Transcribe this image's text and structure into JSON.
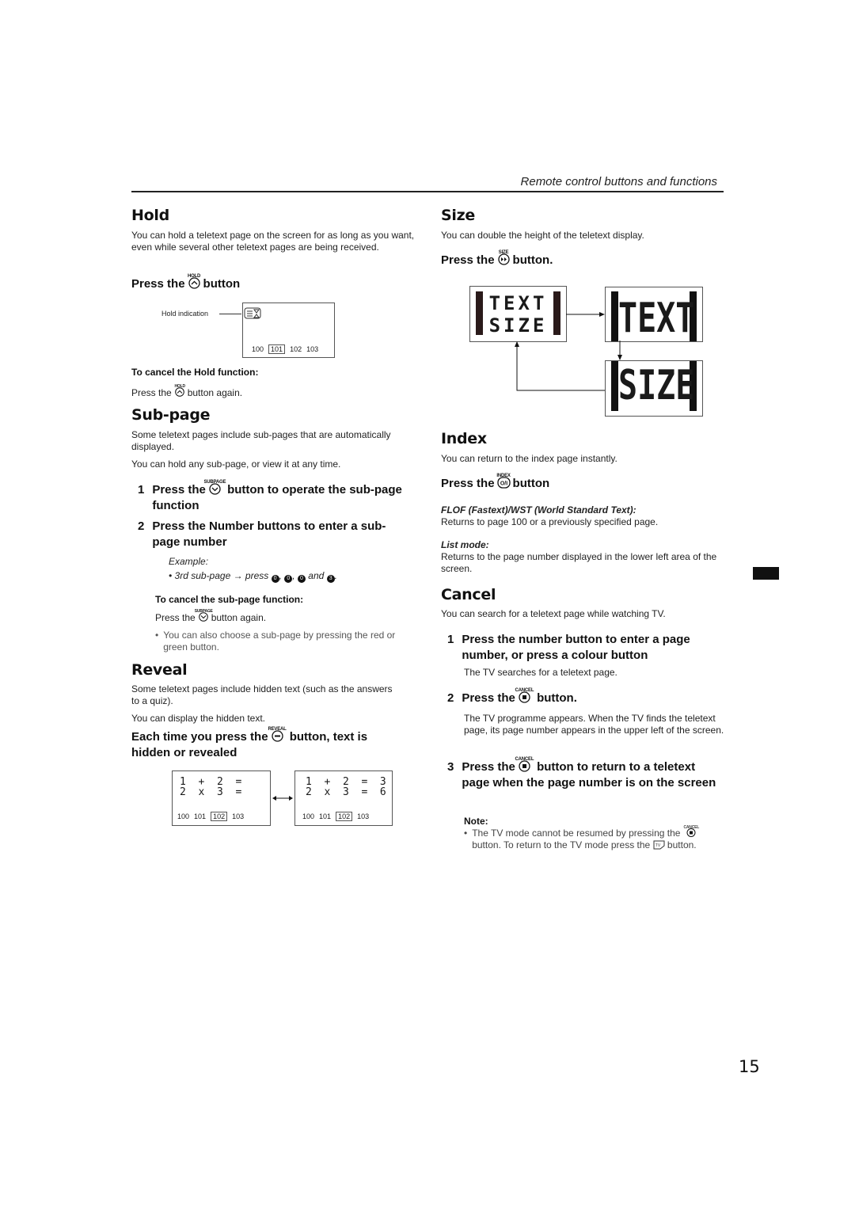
{
  "header": {
    "section": "Remote control buttons and functions"
  },
  "page_number": "15",
  "hold": {
    "title": "Hold",
    "intro": "You can hold a teletext page on the screen for as long as you want, even while several other teletext pages are being received.",
    "press_pre": "Press the",
    "button_label": "HOLD",
    "press_post": "button",
    "indication_label": "Hold indication",
    "pages": [
      "100",
      "101",
      "102",
      "103"
    ],
    "cancel_title": "To cancel the Hold function:",
    "cancel_pre": "Press the",
    "cancel_post": "button again."
  },
  "subpage": {
    "title": "Sub-page",
    "intro1": "Some teletext pages include sub-pages that are automatically displayed.",
    "intro2": "You can hold any sub-page, or view it at any time.",
    "button_label": "SUBPAGE",
    "step1_num": "1",
    "step1_pre": "Press the",
    "step1_post": "button to operate the sub-page function",
    "step2_num": "2",
    "step2": "Press the Number buttons to enter a sub-page number",
    "example_label": "Example:",
    "example_pre": "• 3rd sub-page → press",
    "example_keys": [
      "0",
      "0",
      "0",
      "3"
    ],
    "example_and": "and",
    "cancel_title": "To cancel the sub-page function:",
    "cancel_pre": "Press the",
    "cancel_post": "button again.",
    "note": "You can also choose a sub-page by pressing the red or green button."
  },
  "reveal": {
    "title": "Reveal",
    "intro1": "Some teletext pages include hidden text (such as the answers to a quiz).",
    "intro2": "You can display the hidden text.",
    "button_label": "REVEAL",
    "step_pre": "Each time you press the",
    "step_post": "button, text is hidden or revealed",
    "hidden_screen": {
      "line1": "1  +  2  =",
      "line2": "2  x  3  ="
    },
    "revealed_screen": {
      "line1": "1  +  2  =  3",
      "line2": "2  x  3  =  6"
    },
    "pages": [
      "100",
      "101",
      "102",
      "103"
    ]
  },
  "size": {
    "title": "Size",
    "intro": "You can double the height of the teletext display.",
    "press_pre": "Press the",
    "button_label": "SIZE",
    "press_post": "button.",
    "line1": "TEXT",
    "line2": "SIZE"
  },
  "index": {
    "title": "Index",
    "intro": "You can return to the index page instantly.",
    "press_pre": "Press the",
    "button_label": "INDEX",
    "press_post": "button",
    "flof_title": "FLOF (Fastext)/WST (World Standard Text):",
    "flof_text": "Returns to page 100 or a previously specified page.",
    "list_title": "List mode:",
    "list_text": "Returns to the page number displayed in the lower left area of the screen."
  },
  "cancel": {
    "title": "Cancel",
    "intro": "You can search for a teletext page while watching TV.",
    "button_label": "CANCEL",
    "step1_num": "1",
    "step1": "Press the number button to enter a page number, or press a colour button",
    "step1_sub": "The TV searches for a teletext page.",
    "step2_num": "2",
    "step2_pre": "Press the",
    "step2_post": "button.",
    "step2_sub": "The TV programme appears. When the TV finds the teletext page, its page number appears in the upper left of the screen.",
    "step3_num": "3",
    "step3_pre": "Press the",
    "step3_post": "button to return to a teletext page when the page number is on the screen",
    "note_title": "Note:",
    "note_pre": "The TV mode cannot be resumed by pressing the",
    "note_mid": "button. To return to the TV mode press the",
    "note_post": "button."
  }
}
